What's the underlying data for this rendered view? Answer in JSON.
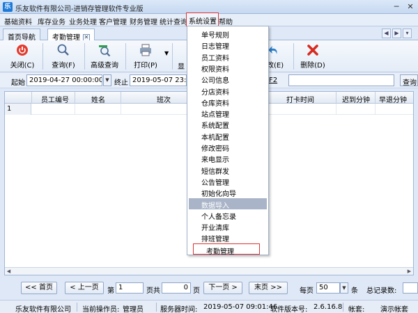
{
  "window": {
    "title": "乐友软件有限公司-进销存管理软件专业版",
    "app_icon": "乐",
    "minimize": "─",
    "close": "✕"
  },
  "menubar": [
    "基础资料",
    "库存业务",
    "业务处理",
    "客户管理",
    "财务管理",
    "统计查询",
    "系统设置",
    "帮助"
  ],
  "tabs": [
    {
      "label": "首页导航"
    },
    {
      "label": "考勤管理",
      "close": "✕"
    }
  ],
  "toolbar": {
    "close": "关闭(C)",
    "query": "查询(F)",
    "advanced_query": "高级查询",
    "print": "打印(P)",
    "show": "显",
    "edit": "改(E)",
    "delete": "删除(D)"
  },
  "filter": {
    "start_label": "起始",
    "start_value": "2019-04-27 00:00:00",
    "end_label": "终止",
    "end_value": "2019-05-07 23:5",
    "hotkey": "F2",
    "query_label": "查询"
  },
  "grid": {
    "columns": [
      "员工编号",
      "姓名",
      "班次",
      "打卡时间",
      "迟到分钟",
      "早退分钟"
    ],
    "rows": [
      [
        "1"
      ]
    ]
  },
  "dropdown": {
    "items": [
      "单号规则",
      "日志管理",
      "员工资料",
      "权限资料",
      "公司信息",
      "分店资料",
      "仓库资料",
      "站点管理",
      "系统配置",
      "本机配置",
      "修改密码",
      "来电显示",
      "短信群发",
      "公告管理",
      "初始化向导",
      "数据导入",
      "个人备忘录",
      "开业清库",
      "排班管理",
      "考勤管理"
    ],
    "highlighted_index": 15,
    "selected_index": 19
  },
  "pager": {
    "first": "<< 首页",
    "prev": "< 上一页",
    "page_prefix": "第",
    "page_value": "1",
    "total_pages_label": "页共",
    "total_pages": "0",
    "page_suffix": "页",
    "next": "下一页 >",
    "last": "末页 >>",
    "per_page_label": "每页",
    "per_page_value": "50",
    "per_page_unit": "条",
    "total_records_label": "总记录数:"
  },
  "status": {
    "company": "乐友软件有限公司",
    "operator_label": "当前操作员:",
    "operator": "管理员",
    "server_time_label": "服务器时间:",
    "server_time": "2019-05-07 09:01:46",
    "version_label": "软件版本号:",
    "version": "2.6.16.8",
    "account_label": "帐套:",
    "account": "演示帐套"
  },
  "colors": {
    "accent": "#d33333",
    "highlight": "#a9b4c8",
    "chrome": "#dfe8f6"
  }
}
